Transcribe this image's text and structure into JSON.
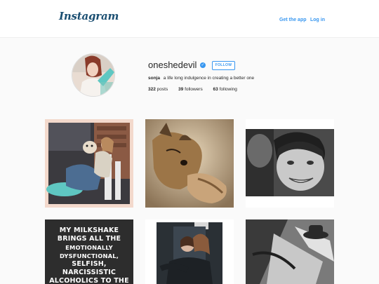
{
  "header": {
    "logo_text": "Instagram",
    "get_app_label": "Get the app",
    "login_label": "Log in"
  },
  "profile": {
    "username": "oneshedevil",
    "verified_glyph": "✓",
    "follow_label": "FOLLOW",
    "display_name": "sonja",
    "bio": "a life long indulgence in creating a better one",
    "stats": [
      {
        "count": "322",
        "label": "posts"
      },
      {
        "count": "39",
        "label": "followers"
      },
      {
        "count": "63",
        "label": "following"
      }
    ]
  },
  "posts": [
    {
      "type": "photo",
      "subject": "woman-with-dog-on-porch"
    },
    {
      "type": "photo",
      "subject": "sleeping-terrier"
    },
    {
      "type": "photo",
      "subject": "smiling-boy-bw"
    },
    {
      "type": "meme",
      "lines": [
        "MY MILKSHAKE",
        "BRINGS ALL THE",
        "EMOTIONALLY DYSFUNCTIONAL,",
        "SELFISH, NARCISSISTIC",
        "ALCOHOLICS TO THE YARD"
      ]
    },
    {
      "type": "photo",
      "subject": "two-women-in-doorway"
    },
    {
      "type": "photo",
      "subject": "man-in-hat-bw"
    }
  ],
  "colors": {
    "accent": "#3897f0",
    "logo": "#1b4f72",
    "background": "#fafafa"
  }
}
